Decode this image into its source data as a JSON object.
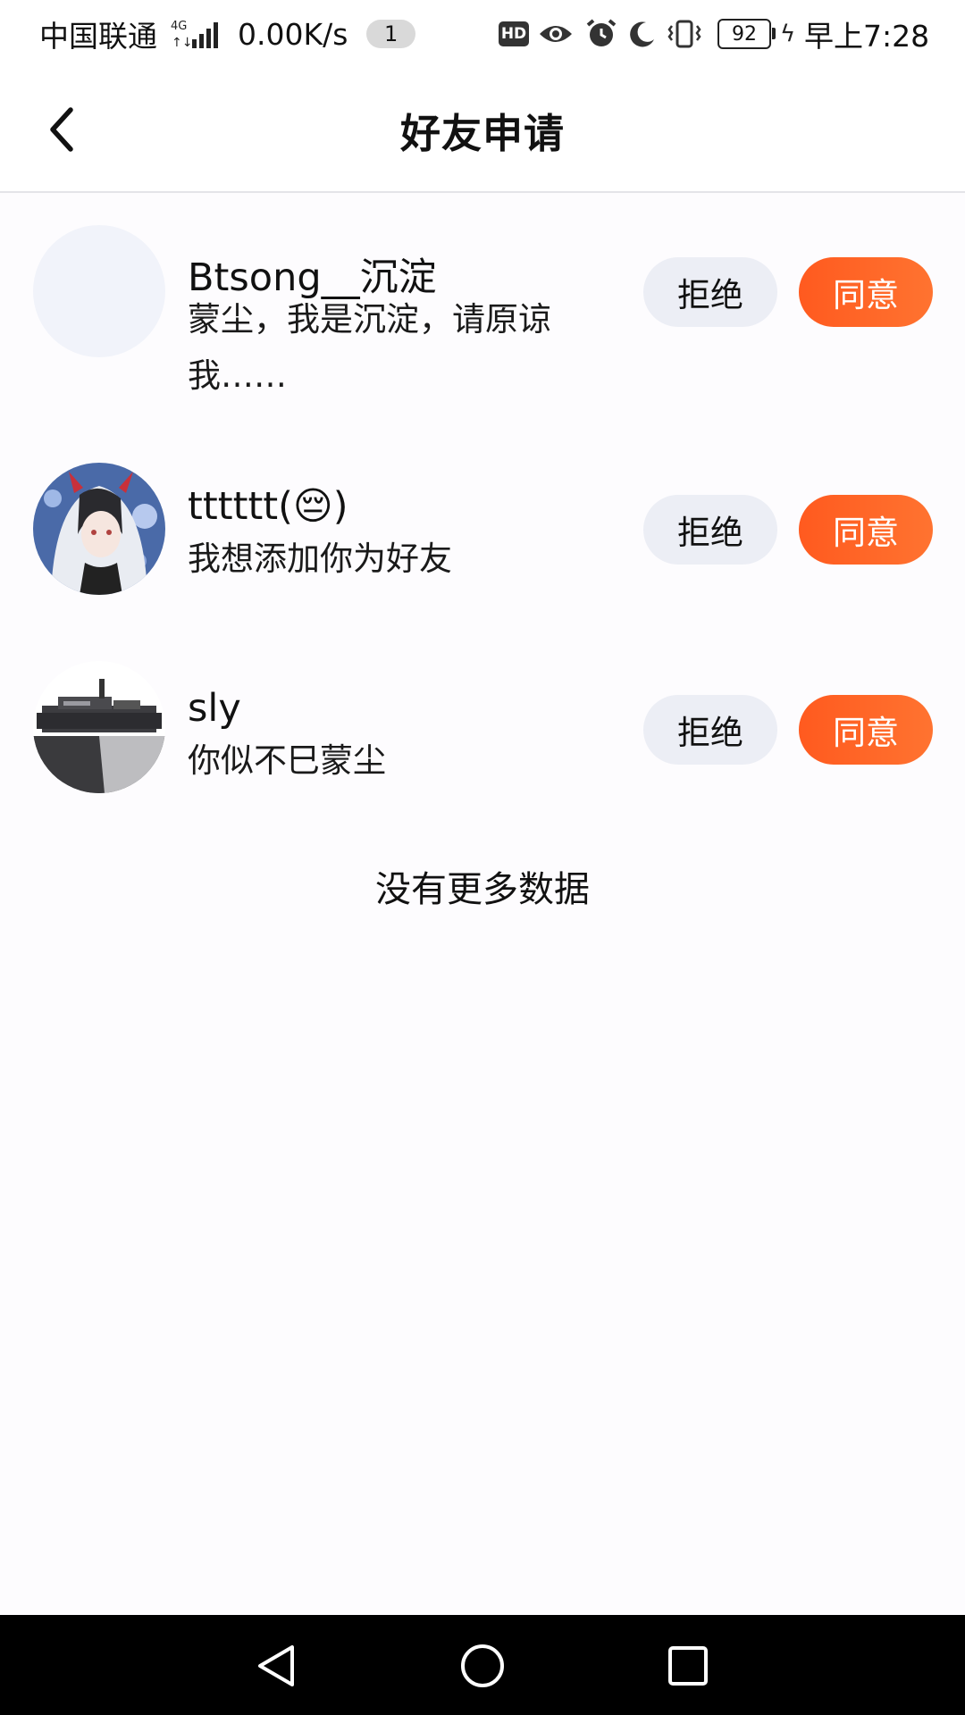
{
  "status_bar": {
    "carrier": "中国联通",
    "network": "4G",
    "speed": "0.00K/s",
    "notification_count": "1",
    "hd": "HD",
    "battery": "92",
    "time": "早上7:28"
  },
  "header": {
    "title": "好友申请"
  },
  "requests": [
    {
      "name": "Btsong__沉淀",
      "message": "蒙尘，我是沉淀，请原谅我……",
      "reject_label": "拒绝",
      "accept_label": "同意"
    },
    {
      "name": "tttttt(😔)",
      "message": "我想添加你为好友",
      "reject_label": "拒绝",
      "accept_label": "同意"
    },
    {
      "name": "sly",
      "message": "你似不巳蒙尘",
      "reject_label": "拒绝",
      "accept_label": "同意"
    }
  ],
  "footer_text": "没有更多数据",
  "colors": {
    "accent_orange": "#ff5a1f",
    "reject_bg": "#eceef5",
    "page_bg": "#fdfcfe"
  }
}
